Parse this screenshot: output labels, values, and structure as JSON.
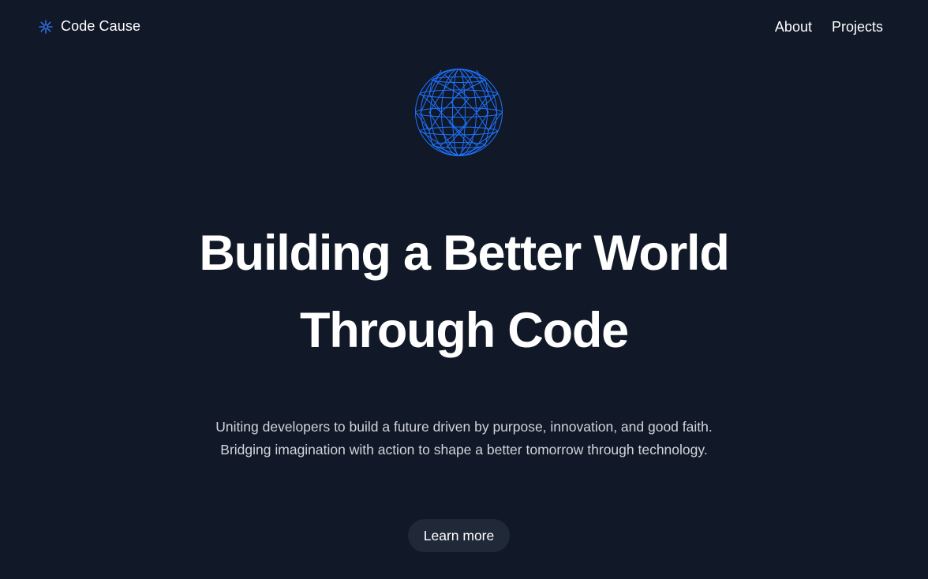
{
  "brand": {
    "name": "Code Cause",
    "icon": "asterisk-logo-icon",
    "accent": "#2f6fe0"
  },
  "nav": {
    "links": [
      {
        "label": "About"
      },
      {
        "label": "Projects"
      }
    ]
  },
  "hero": {
    "graphic": "wireframe-globe-icon",
    "graphic_color": "#1e73ff",
    "headline_line1": "Building a Better World",
    "headline_line2": "Through Code",
    "subtitle_line1": "Uniting developers to build a future driven by purpose, innovation, and good faith.",
    "subtitle_line2": "Bridging imagination with action to shape a better tomorrow through technology.",
    "cta_label": "Learn more"
  },
  "colors": {
    "background": "#111827",
    "text": "#ffffff",
    "muted_text": "#d1d5db",
    "button_bg": "#1f2937"
  }
}
